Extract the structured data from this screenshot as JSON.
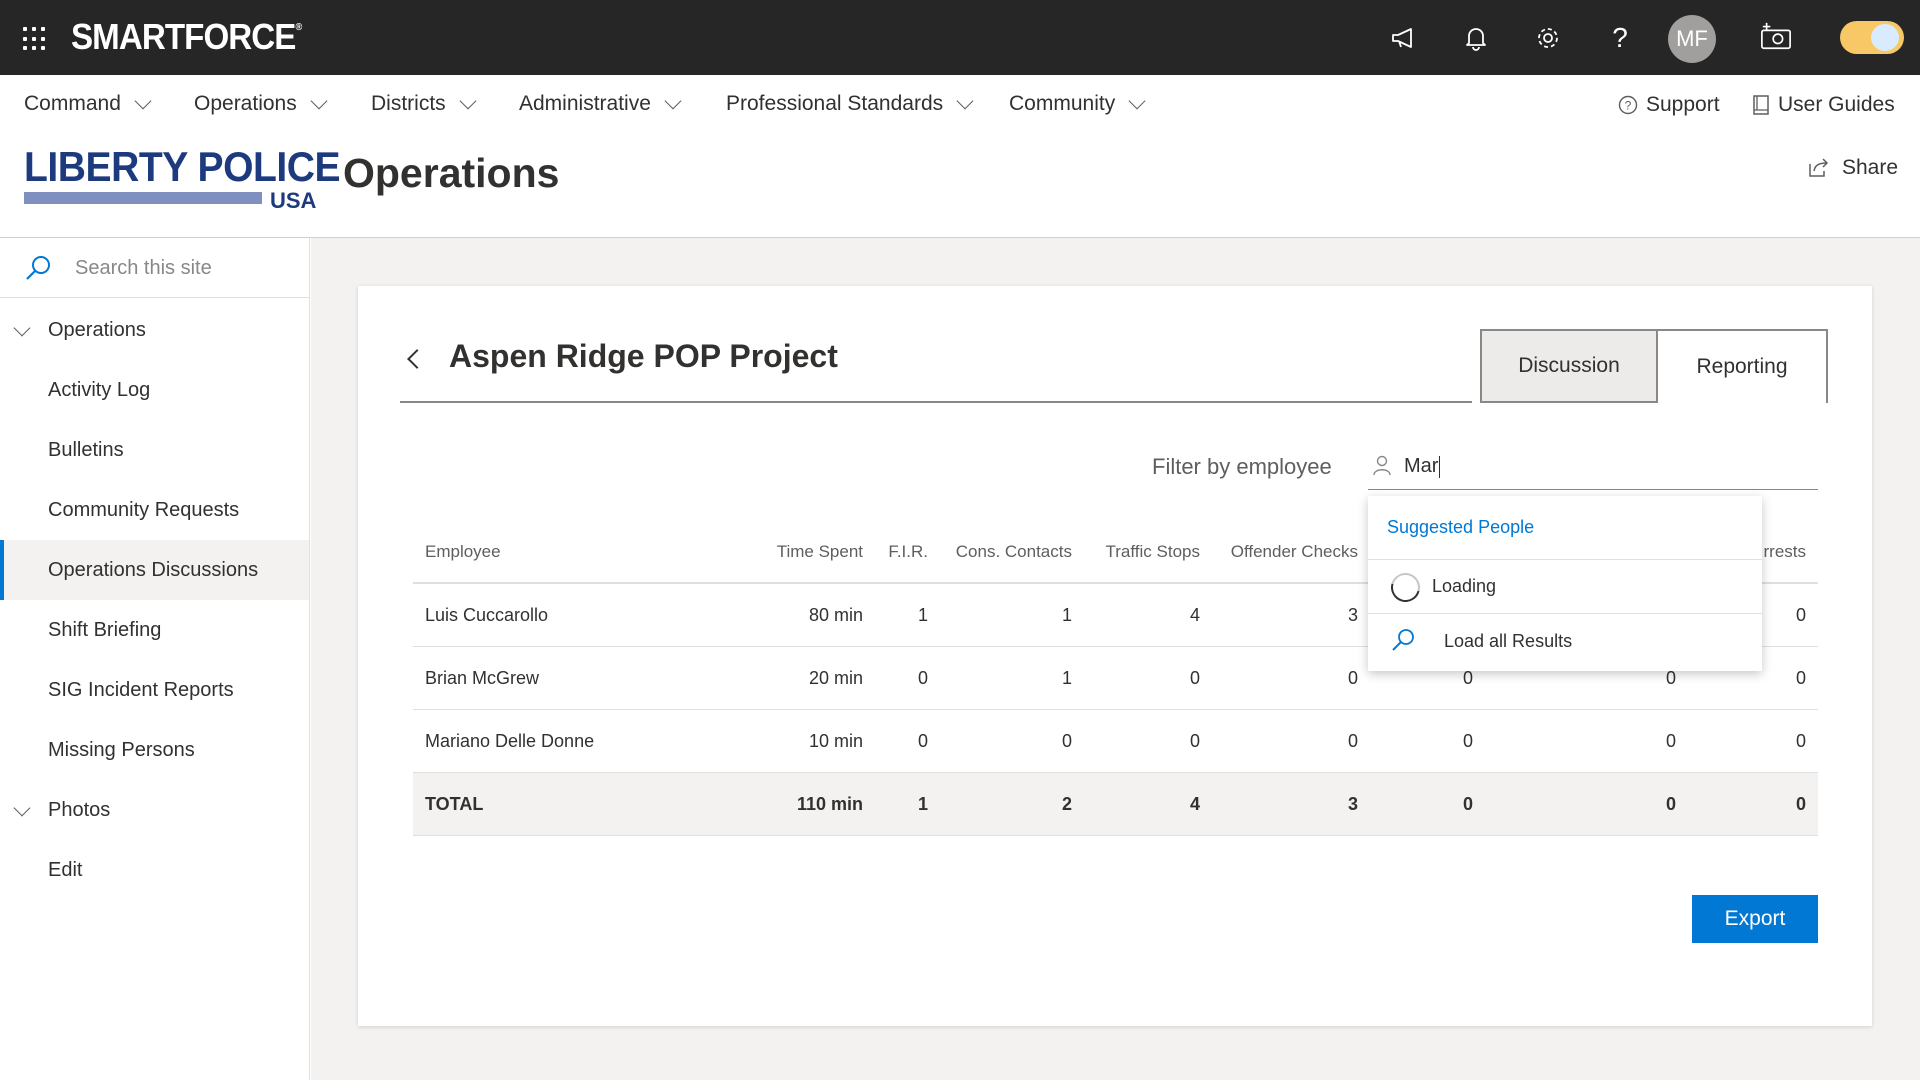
{
  "suitebar": {
    "brand": "SMARTFORCE",
    "brand_mark": "®",
    "avatar_initials": "MF"
  },
  "topnav": {
    "items": [
      {
        "label": "Command"
      },
      {
        "label": "Operations"
      },
      {
        "label": "Districts"
      },
      {
        "label": "Administrative"
      },
      {
        "label": "Professional Standards"
      },
      {
        "label": "Community"
      }
    ],
    "support": "Support",
    "user_guides": "User Guides"
  },
  "header": {
    "logo_top": "LIBERTY POLICE",
    "logo_bottom": "USA",
    "title": "Operations",
    "share": "Share"
  },
  "leftnav": {
    "search_placeholder": "Search this site",
    "items": [
      {
        "label": "Operations"
      },
      {
        "label": "Activity Log"
      },
      {
        "label": "Bulletins"
      },
      {
        "label": "Community Requests"
      },
      {
        "label": "Operations Discussions"
      },
      {
        "label": "Shift Briefing"
      },
      {
        "label": "SIG Incident Reports"
      },
      {
        "label": "Missing Persons"
      },
      {
        "label": "Photos"
      },
      {
        "label": "Edit"
      }
    ]
  },
  "card": {
    "title": "Aspen Ridge POP Project",
    "tabs": [
      {
        "label": "Discussion"
      },
      {
        "label": "Reporting"
      }
    ],
    "filter_label": "Filter by employee",
    "filter_value": "Mar",
    "export_label": "Export"
  },
  "table": {
    "columns": [
      "Employee",
      "Time Spent",
      "F.I.R.",
      "Cons. Contacts",
      "Traffic Stops",
      "Offender Checks",
      "",
      "",
      "rrests"
    ],
    "rows": [
      [
        "Luis Cuccarollo",
        "80 min",
        "1",
        "1",
        "4",
        "3",
        "",
        "",
        "0"
      ],
      [
        "Brian McGrew",
        "20 min",
        "0",
        "1",
        "0",
        "0",
        "0",
        "0",
        "0"
      ],
      [
        "Mariano Delle Donne",
        "10 min",
        "0",
        "0",
        "0",
        "0",
        "0",
        "0",
        "0"
      ]
    ],
    "total": [
      "TOTAL",
      "110 min",
      "1",
      "2",
      "4",
      "3",
      "0",
      "0",
      "0"
    ]
  },
  "suggestions": {
    "header": "Suggested People",
    "loading": "Loading",
    "load_all": "Load all Results"
  },
  "colors": {
    "suitebar_bg": "#262626",
    "accent": "#0078d4",
    "logo_blue": "#1d3a7e"
  }
}
